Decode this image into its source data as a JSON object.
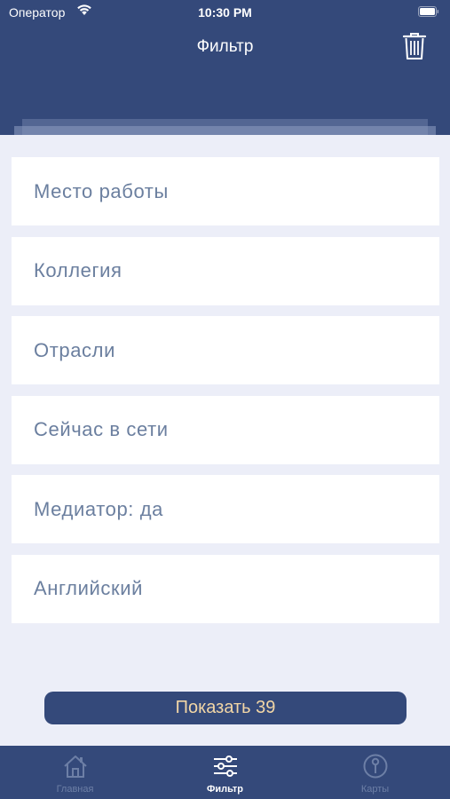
{
  "status_bar": {
    "carrier": "Оператор",
    "time": "10:30 PM"
  },
  "header": {
    "title": "Фильтр",
    "trash_icon": "trash-icon"
  },
  "filters": [
    {
      "label": "Место работы"
    },
    {
      "label": "Коллегия"
    },
    {
      "label": "Отрасли"
    },
    {
      "label": "Сейчас в сети"
    },
    {
      "label": "Медиатор: да"
    },
    {
      "label": "Английский"
    }
  ],
  "show_button": {
    "label": "Показать 39"
  },
  "tab_bar": {
    "items": [
      {
        "label": "Главная",
        "icon": "home-icon"
      },
      {
        "label": "Фильтр",
        "icon": "sliders-icon",
        "active": true
      },
      {
        "label": "Карты",
        "icon": "map-pin-icon"
      }
    ]
  },
  "colors": {
    "primary": "#34497a",
    "background": "#eceef8",
    "filter_text": "#6b7f9f",
    "button_text": "#f2d6a6",
    "tab_inactive": "#6d7fa6"
  }
}
